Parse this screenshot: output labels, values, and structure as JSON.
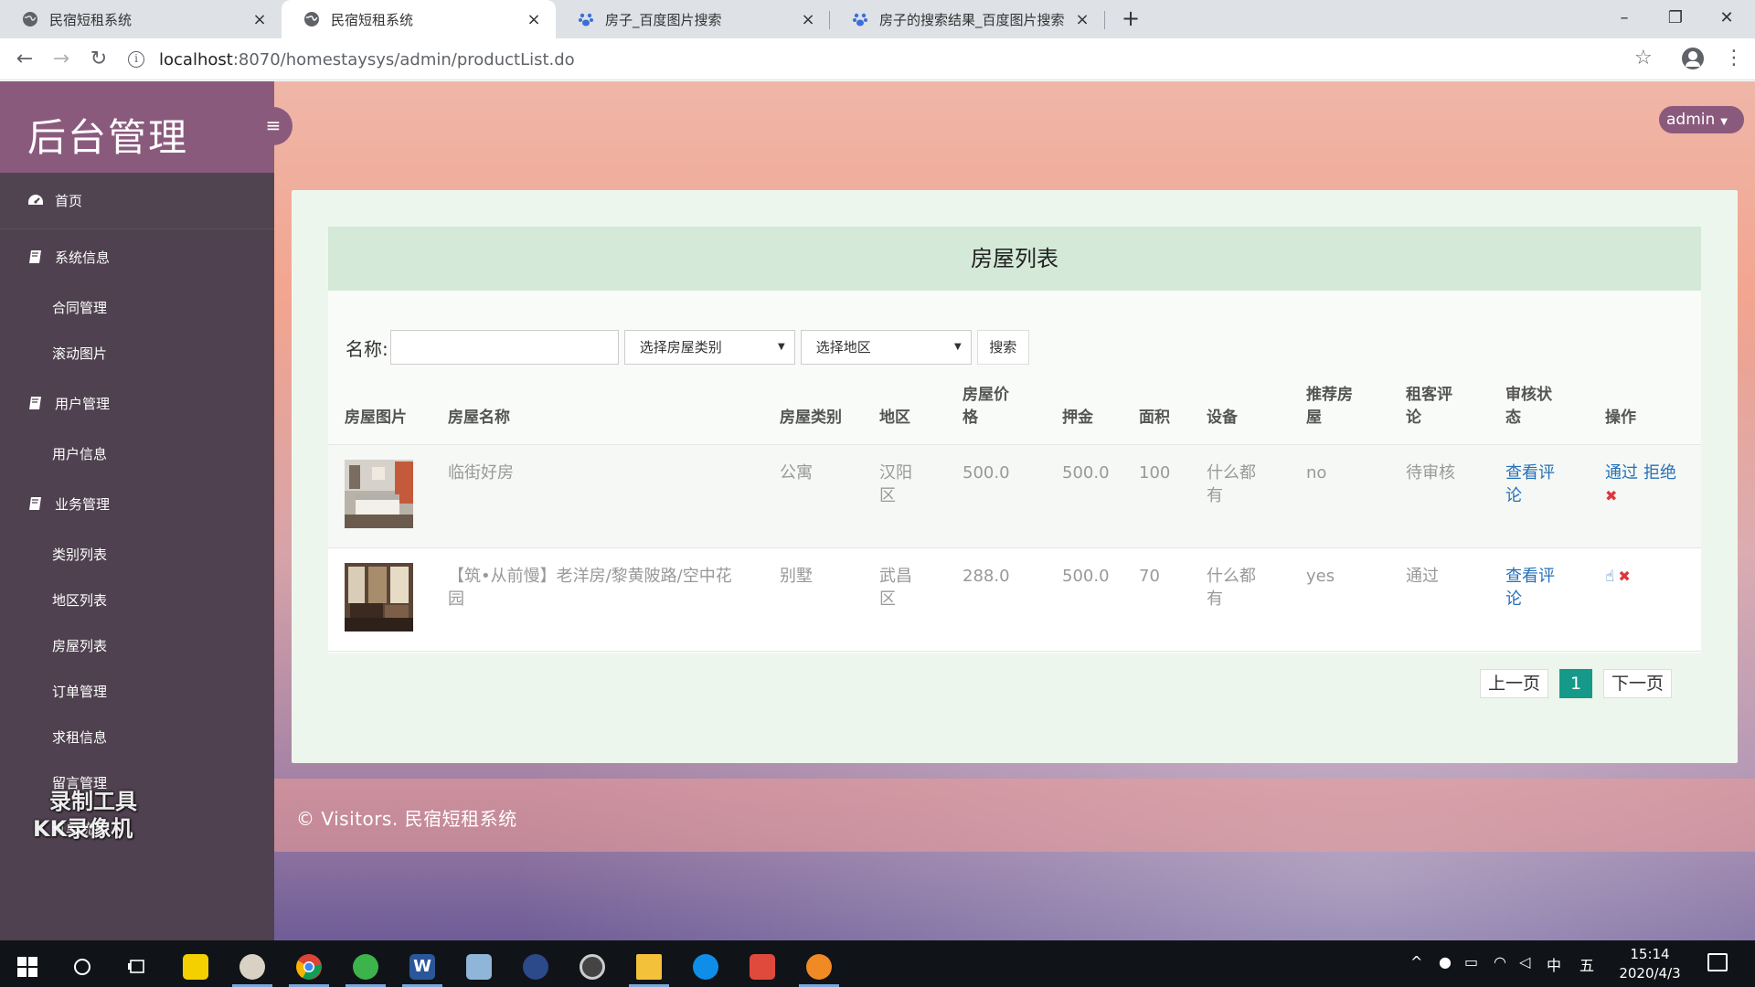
{
  "browser": {
    "tabs": [
      {
        "title": "民宿短租系统"
      },
      {
        "title": "民宿短租系统"
      },
      {
        "title": "房子_百度图片搜索"
      },
      {
        "title": "房子的搜索结果_百度图片搜索"
      }
    ],
    "url_host": "localhost",
    "url_rest": ":8070/homestaysys/admin/productList.do"
  },
  "sidebar": {
    "brand": "后台管理",
    "home": "首页",
    "groups": [
      {
        "label": "系统信息",
        "items": [
          "合同管理",
          "滚动图片"
        ]
      },
      {
        "label": "用户管理",
        "items": [
          "用户信息"
        ]
      },
      {
        "label": "业务管理",
        "items": [
          "类别列表",
          "地区列表",
          "房屋列表",
          "订单管理",
          "求租信息",
          "留言管理",
          "订单统计"
        ]
      }
    ],
    "watermark_line1": "录制工具",
    "watermark_line2": "KK录像机"
  },
  "header": {
    "user": "admin"
  },
  "panel": {
    "title": "房屋列表",
    "filters": {
      "name_label": "名称:",
      "name_value": "",
      "category_placeholder": "选择房屋类别",
      "region_placeholder": "选择地区",
      "search_button": "搜索"
    },
    "columns": [
      "房屋图片",
      "房屋名称",
      "房屋类别",
      "地区",
      "房屋价格",
      "押金",
      "面积",
      "设备",
      "推荐房屋",
      "租客评论",
      "审核状态",
      "操作"
    ],
    "rows": [
      {
        "name": "临街好房",
        "category": "公寓",
        "region": "汉阳区",
        "price": "500.0",
        "deposit": "500.0",
        "area": "100",
        "equipment": "什么都有",
        "recommend": "no",
        "review_status": "待审核",
        "comments_link": "查看评论",
        "actions": [
          "通过",
          "拒绝"
        ]
      },
      {
        "name": "【筑•从前慢】老洋房/黎黄陂路/空中花园",
        "category": "别墅",
        "region": "武昌区",
        "price": "288.0",
        "deposit": "500.0",
        "area": "70",
        "equipment": "什么都有",
        "recommend": "yes",
        "review_status": "通过",
        "comments_link": "查看评论",
        "actions": []
      }
    ],
    "pagination": {
      "prev": "上一页",
      "current": "1",
      "next": "下一页"
    }
  },
  "footer": {
    "text": "© Visitors. 民宿短租系统"
  },
  "taskbar": {
    "ime_lang": "中",
    "ime_mode": "五",
    "time": "15:14",
    "date": "2020/4/3"
  },
  "colors": {
    "brand": "#8a5a7d",
    "sidebar": "#4f414f",
    "accent_page": "#159a8a",
    "link": "#2770b8",
    "danger": "#e0353b"
  }
}
